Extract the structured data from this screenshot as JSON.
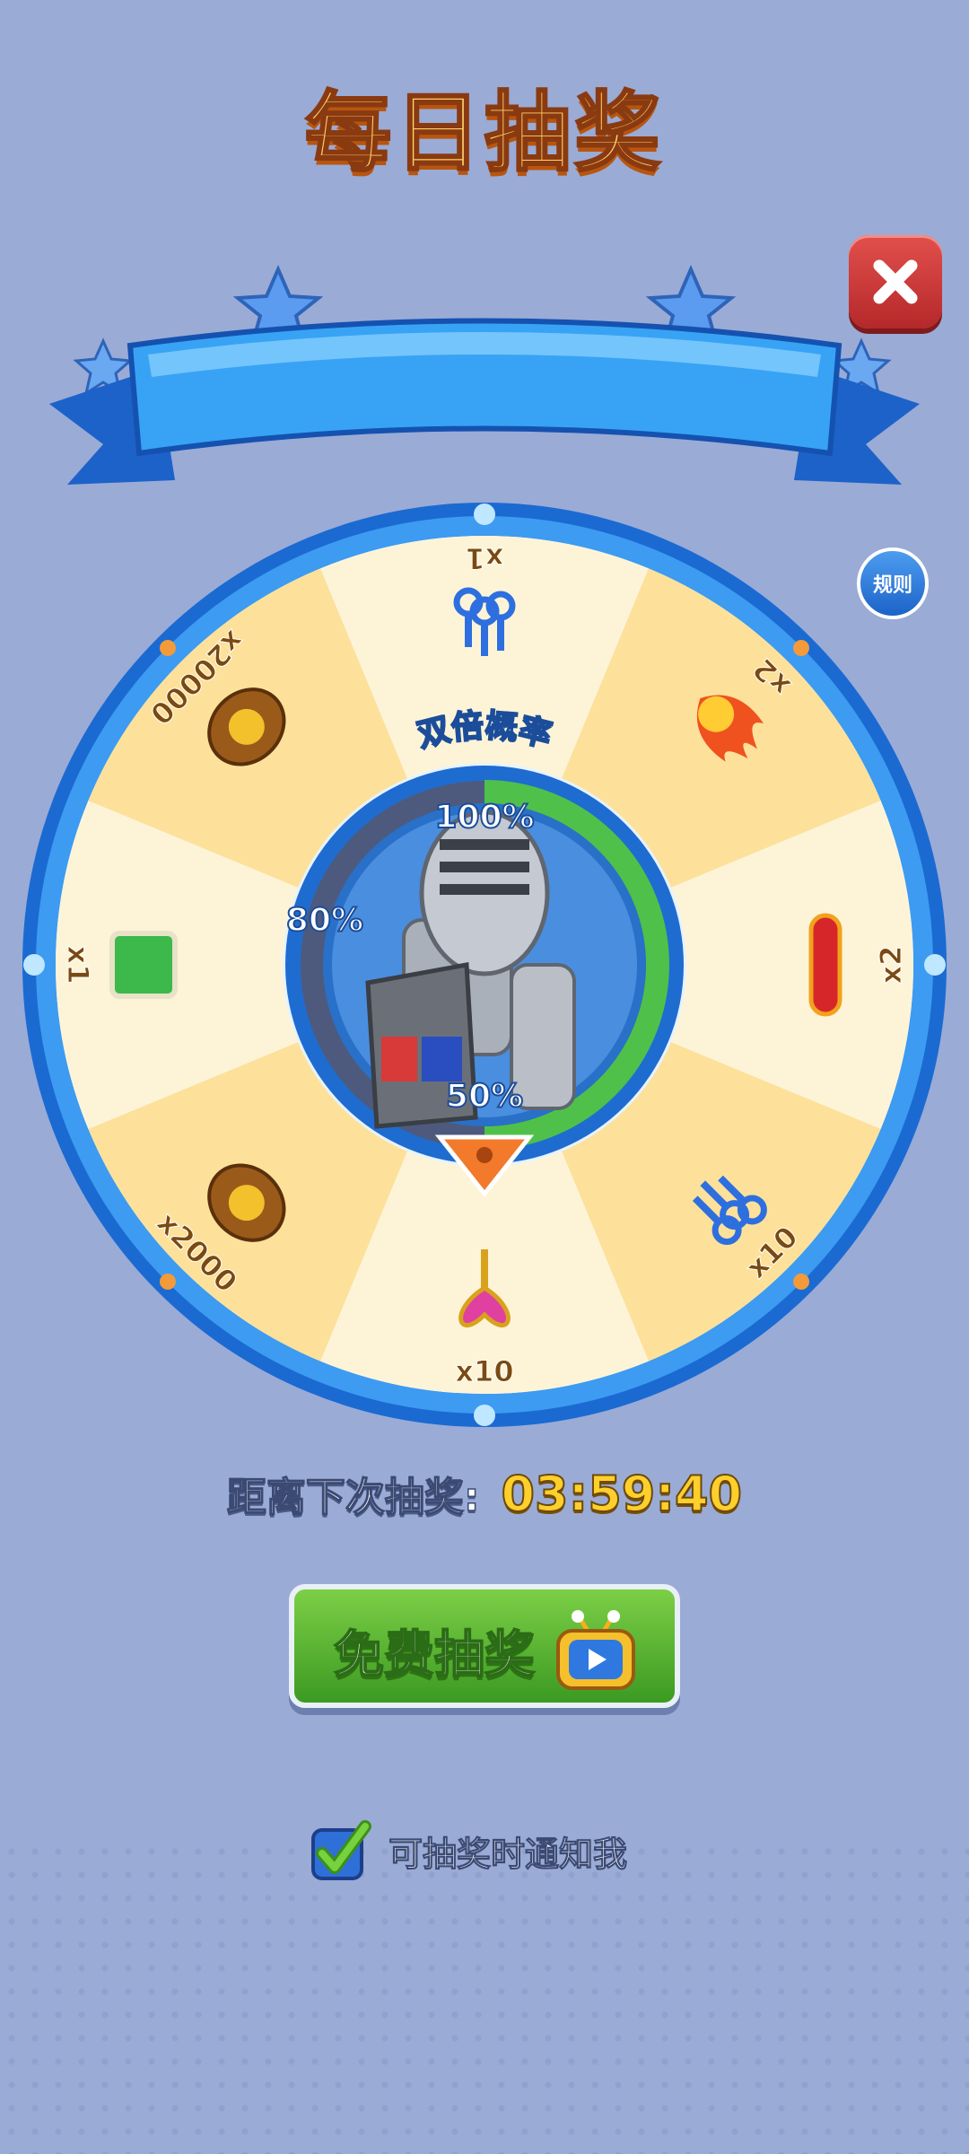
{
  "title": "每日抽奖",
  "rules_label": "规则",
  "wheel": {
    "double_chance_label": "双倍概率",
    "progress_labels": [
      "100%",
      "80%",
      "50%"
    ],
    "progress_value": 0.5,
    "segments": [
      {
        "icon": "keys-blue-icon",
        "amount": "x1"
      },
      {
        "icon": "fire-boost-icon",
        "amount": "x2"
      },
      {
        "icon": "skateboard-icon",
        "amount": "x2"
      },
      {
        "icon": "keys-blue-icon",
        "amount": "x10"
      },
      {
        "icon": "golden-heart-key-icon",
        "amount": "x10"
      },
      {
        "icon": "coin-bag-icon",
        "amount": "x2000"
      },
      {
        "icon": "mystery-box-icon",
        "amount": "x1"
      },
      {
        "icon": "coin-bag-icon",
        "amount": "x20000"
      }
    ]
  },
  "timer": {
    "label": "距离下次抽奖:",
    "value": "03:59:40"
  },
  "spin_button": {
    "label": "免费抽奖"
  },
  "notify": {
    "label": "可抽奖时通知我",
    "checked": true
  },
  "colors": {
    "background": "#9aabd6",
    "wheel_rim": "#1f7fe0",
    "seg_yellow": "#fde19a",
    "seg_cream": "#fdf4d8",
    "button_green": "#55b52f",
    "timer_gold": "#ffcf2b"
  }
}
